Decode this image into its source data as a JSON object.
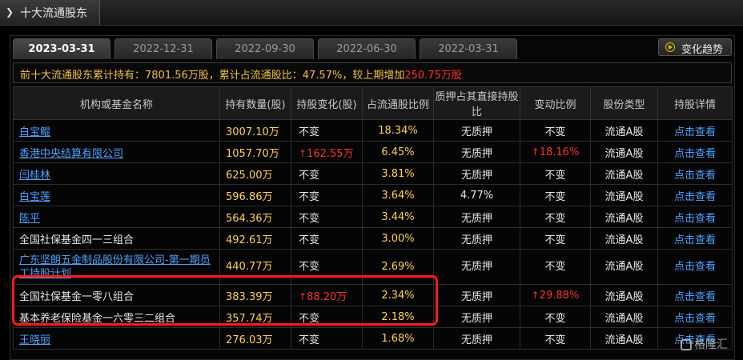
{
  "window": {
    "title": "十大流通股东"
  },
  "tabs": [
    {
      "label": "2023-03-31",
      "active": true
    },
    {
      "label": "2022-12-31",
      "active": false
    },
    {
      "label": "2022-09-30",
      "active": false
    },
    {
      "label": "2022-06-30",
      "active": false
    },
    {
      "label": "2022-03-31",
      "active": false
    }
  ],
  "trend_button": {
    "label": "变化趋势"
  },
  "summary": {
    "part1": "前十大流通股东累计持有：7801.56万股，累计占流通股比：47.57%，较上期增加",
    "increase": "250.75万股"
  },
  "table": {
    "headers": [
      "机构或基金名称",
      "持有数量(股)",
      "持股变化(股)",
      "占流通股比例",
      "质押占其直接持股比",
      "变动比例",
      "股份类型",
      "持股详情"
    ],
    "rows": [
      {
        "name": "白宝鲲",
        "link": true,
        "qty": "3007.10万",
        "change": "不变",
        "change_up": false,
        "ratio": "18.34%",
        "pledge": "无质押",
        "vary": "不变",
        "vary_up": false,
        "type": "流通A股",
        "detail": "点击查看"
      },
      {
        "name": "香港中央结算有限公司",
        "link": true,
        "qty": "1057.70万",
        "change": "162.55万",
        "change_up": true,
        "ratio": "6.45%",
        "pledge": "无质押",
        "vary": "18.16%",
        "vary_up": true,
        "type": "流通A股",
        "detail": "点击查看"
      },
      {
        "name": "闫桂林",
        "link": true,
        "qty": "625.00万",
        "change": "不变",
        "change_up": false,
        "ratio": "3.81%",
        "pledge": "无质押",
        "vary": "不变",
        "vary_up": false,
        "type": "流通A股",
        "detail": "点击查看"
      },
      {
        "name": "白宝莲",
        "link": true,
        "qty": "596.86万",
        "change": "不变",
        "change_up": false,
        "ratio": "3.64%",
        "pledge": "4.77%",
        "vary": "不变",
        "vary_up": false,
        "type": "流通A股",
        "detail": "点击查看"
      },
      {
        "name": "陈平",
        "link": true,
        "qty": "564.36万",
        "change": "不变",
        "change_up": false,
        "ratio": "3.44%",
        "pledge": "无质押",
        "vary": "不变",
        "vary_up": false,
        "type": "流通A股",
        "detail": "点击查看"
      },
      {
        "name": "全国社保基金四一三组合",
        "link": false,
        "qty": "492.61万",
        "change": "不变",
        "change_up": false,
        "ratio": "3.00%",
        "pledge": "无质押",
        "vary": "不变",
        "vary_up": false,
        "type": "流通A股",
        "detail": "点击查看"
      },
      {
        "name": "广东坚朗五金制品股份有限公司-第一期员工持股计划",
        "link": true,
        "qty": "440.77万",
        "change": "不变",
        "change_up": false,
        "ratio": "2.69%",
        "pledge": "无质押",
        "vary": "不变",
        "vary_up": false,
        "type": "流通A股",
        "detail": "点击查看"
      },
      {
        "name": "全国社保基金一零八组合",
        "link": false,
        "qty": "383.39万",
        "change": "88.20万",
        "change_up": true,
        "ratio": "2.34%",
        "pledge": "无质押",
        "vary": "29.88%",
        "vary_up": true,
        "type": "流通A股",
        "detail": "点击查看"
      },
      {
        "name": "基本养老保险基金一六零三二组合",
        "link": false,
        "qty": "357.74万",
        "change": "不变",
        "change_up": false,
        "ratio": "2.18%",
        "pledge": "无质押",
        "vary": "不变",
        "vary_up": false,
        "type": "流通A股",
        "detail": "点击查看"
      },
      {
        "name": "王晓丽",
        "link": true,
        "qty": "276.03万",
        "change": "不变",
        "change_up": false,
        "ratio": "1.68%",
        "pledge": "无质押",
        "vary": "不变",
        "vary_up": false,
        "type": "流通A股",
        "detail": "点击查看"
      }
    ]
  },
  "watermark": {
    "text": "格隆汇"
  },
  "colors": {
    "accent_yellow": "#ffd34d",
    "link_blue": "#4aa3ff",
    "up_red": "#ff3030",
    "highlight_red": "#ff1a1a"
  }
}
